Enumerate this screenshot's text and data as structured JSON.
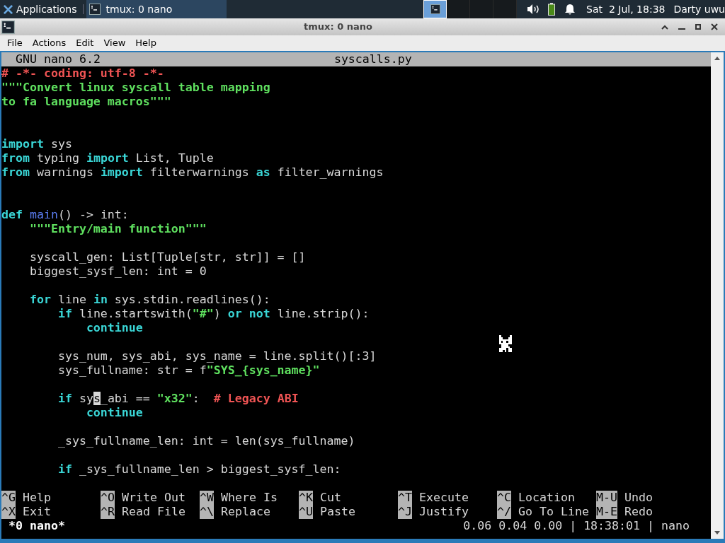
{
  "panel": {
    "menu_label": "Applications",
    "tasks": [
      {
        "label": "tmux: 0 nano",
        "selected": true
      }
    ],
    "workspaces": [
      {
        "selected": true
      },
      {
        "selected": false
      },
      {
        "selected": false
      },
      {
        "selected": false
      }
    ],
    "clock": "Sat  2 Jul, 18:38",
    "user": "Darty uwu"
  },
  "window": {
    "title": "tmux: 0 nano"
  },
  "menu": [
    "File",
    "Actions",
    "Edit",
    "View",
    "Help"
  ],
  "nano": {
    "version": "GNU nano 6.2",
    "filename": "syscalls.py",
    "lines": [
      {
        "kind": "code",
        "segments": [
          {
            "kind": "comment",
            "text": "# -*- coding: utf-8 -*-"
          }
        ]
      },
      {
        "kind": "code",
        "segments": [
          {
            "kind": "string",
            "text": "\"\"\"Convert linux syscall table mapping"
          }
        ]
      },
      {
        "kind": "code",
        "segments": [
          {
            "kind": "string",
            "text": "to fa language macros\"\"\""
          }
        ]
      },
      {
        "kind": "blank"
      },
      {
        "kind": "blank"
      },
      {
        "kind": "code",
        "segments": [
          {
            "kind": "keyword",
            "text": "import"
          },
          {
            "kind": "plain",
            "text": " sys"
          }
        ]
      },
      {
        "kind": "code",
        "segments": [
          {
            "kind": "keyword",
            "text": "from"
          },
          {
            "kind": "plain",
            "text": " typing "
          },
          {
            "kind": "keyword",
            "text": "import"
          },
          {
            "kind": "plain",
            "text": " List, Tuple"
          }
        ]
      },
      {
        "kind": "code",
        "segments": [
          {
            "kind": "keyword",
            "text": "from"
          },
          {
            "kind": "plain",
            "text": " warnings "
          },
          {
            "kind": "keyword",
            "text": "import"
          },
          {
            "kind": "plain",
            "text": " filterwarnings "
          },
          {
            "kind": "keyword",
            "text": "as"
          },
          {
            "kind": "plain",
            "text": " filter_warnings"
          }
        ]
      },
      {
        "kind": "blank"
      },
      {
        "kind": "blank"
      },
      {
        "kind": "code",
        "segments": [
          {
            "kind": "keyword",
            "text": "def"
          },
          {
            "kind": "function",
            "text": " main"
          },
          {
            "kind": "plain",
            "text": "() -> int:"
          }
        ]
      },
      {
        "kind": "code",
        "segments": [
          {
            "kind": "string",
            "text": "    \"\"\"Entry/main function\"\"\""
          }
        ]
      },
      {
        "kind": "blank"
      },
      {
        "kind": "code",
        "segments": [
          {
            "kind": "plain",
            "text": "    syscall_gen: List[Tuple[str, str]] = []"
          }
        ]
      },
      {
        "kind": "code",
        "segments": [
          {
            "kind": "plain",
            "text": "    biggest_sysf_len: int = 0"
          }
        ]
      },
      {
        "kind": "blank"
      },
      {
        "kind": "code",
        "segments": [
          {
            "kind": "keyword",
            "text": "    for"
          },
          {
            "kind": "plain",
            "text": " line "
          },
          {
            "kind": "keyword",
            "text": "in"
          },
          {
            "kind": "plain",
            "text": " sys.stdin.readlines():"
          }
        ]
      },
      {
        "kind": "code",
        "segments": [
          {
            "kind": "keyword",
            "text": "        if"
          },
          {
            "kind": "plain",
            "text": " line.startswith("
          },
          {
            "kind": "string",
            "text": "\"#\""
          },
          {
            "kind": "plain",
            "text": ") "
          },
          {
            "kind": "keyword",
            "text": "or not"
          },
          {
            "kind": "plain",
            "text": " line.strip():"
          }
        ]
      },
      {
        "kind": "code",
        "segments": [
          {
            "kind": "keyword",
            "text": "            continue"
          }
        ]
      },
      {
        "kind": "blank"
      },
      {
        "kind": "code",
        "segments": [
          {
            "kind": "plain",
            "text": "        sys_num, sys_abi, sys_name = line.split()[:3]"
          }
        ]
      },
      {
        "kind": "code",
        "segments": [
          {
            "kind": "plain",
            "text": "        sys_fullname: str = f"
          },
          {
            "kind": "string",
            "text": "\"SYS_{sys_name}\""
          }
        ]
      },
      {
        "kind": "blank"
      },
      {
        "kind": "code",
        "segments": [
          {
            "kind": "keyword",
            "text": "        if"
          },
          {
            "kind": "plain",
            "text": " sy"
          },
          {
            "kind": "cursor",
            "text": "s"
          },
          {
            "kind": "plain",
            "text": "_abi == "
          },
          {
            "kind": "string",
            "text": "\"x32\""
          },
          {
            "kind": "plain",
            "text": ":  "
          },
          {
            "kind": "comment",
            "text": "# Legacy ABI"
          }
        ]
      },
      {
        "kind": "code",
        "segments": [
          {
            "kind": "keyword",
            "text": "            continue"
          }
        ]
      },
      {
        "kind": "blank"
      },
      {
        "kind": "code",
        "segments": [
          {
            "kind": "plain",
            "text": "        _sys_fullname_len: int = len(sys_fullname)"
          }
        ]
      },
      {
        "kind": "blank"
      },
      {
        "kind": "code",
        "segments": [
          {
            "kind": "keyword",
            "text": "        if"
          },
          {
            "kind": "plain",
            "text": " _sys_fullname_len > biggest_sysf_len:"
          }
        ]
      }
    ],
    "shortcuts": [
      {
        "key": "^G",
        "label": "Help"
      },
      {
        "key": "^O",
        "label": "Write Out"
      },
      {
        "key": "^W",
        "label": "Where Is"
      },
      {
        "key": "^K",
        "label": "Cut"
      },
      {
        "key": "^T",
        "label": "Execute"
      },
      {
        "key": "^C",
        "label": "Location"
      },
      {
        "key": "M-U",
        "label": "Undo"
      },
      {
        "key": "^X",
        "label": "Exit"
      },
      {
        "key": "^R",
        "label": "Read File"
      },
      {
        "key": "^\\",
        "label": "Replace"
      },
      {
        "key": "^U",
        "label": "Paste"
      },
      {
        "key": "^J",
        "label": "Justify"
      },
      {
        "key": "^/",
        "label": "Go To Line"
      },
      {
        "key": "M-E",
        "label": "Redo"
      }
    ]
  },
  "tmux": {
    "window": "*0 nano*",
    "status": "0.06 0.04 0.00 | 18:38:01 | nano"
  }
}
